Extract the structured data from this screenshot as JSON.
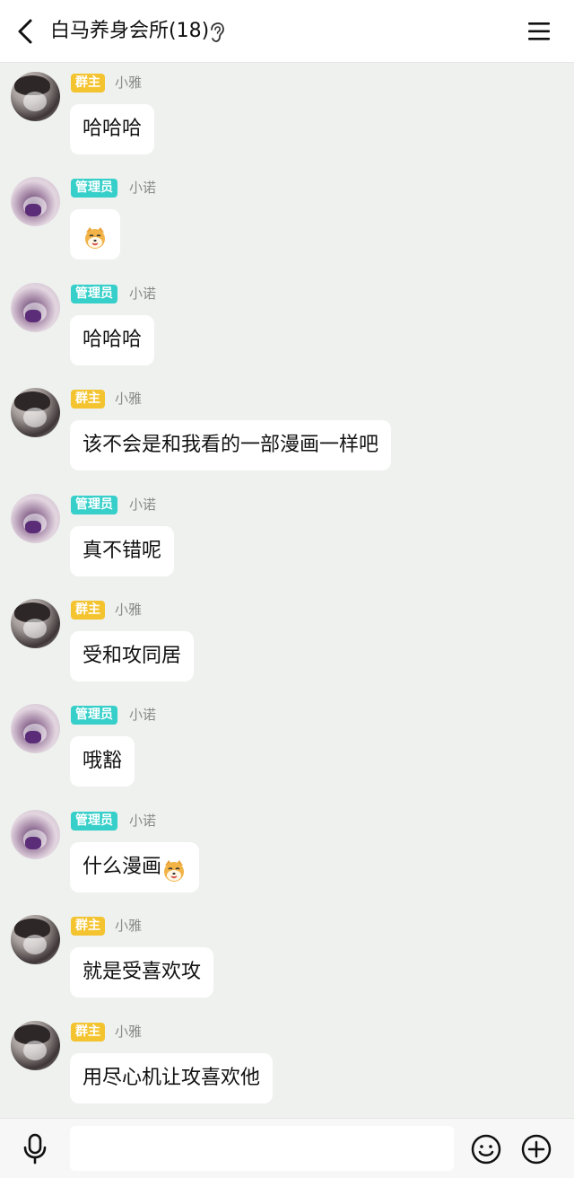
{
  "header": {
    "title": "白马养身会所(18)"
  },
  "icons": {
    "back": "chevron-left-icon",
    "ear": "ear-icon",
    "menu": "hamburger-menu-icon",
    "mic": "microphone-icon",
    "emoji": "smiley-icon",
    "plus": "plus-circle-icon",
    "sticker": "shiba-dog-emoji"
  },
  "colors": {
    "owner_badge": "#f4c430",
    "admin_badge": "#36cfc9",
    "chat_bg": "#eef1ee"
  },
  "messages": [
    {
      "role": "owner",
      "badge": "群主",
      "name": "小雅",
      "text": "哈哈哈"
    },
    {
      "role": "admin",
      "badge": "管理员",
      "name": "小诺",
      "text": "",
      "sticker": true
    },
    {
      "role": "admin",
      "badge": "管理员",
      "name": "小诺",
      "text": "哈哈哈"
    },
    {
      "role": "owner",
      "badge": "群主",
      "name": "小雅",
      "text": "该不会是和我看的一部漫画一样吧"
    },
    {
      "role": "admin",
      "badge": "管理员",
      "name": "小诺",
      "text": "真不错呢"
    },
    {
      "role": "owner",
      "badge": "群主",
      "name": "小雅",
      "text": "受和攻同居"
    },
    {
      "role": "admin",
      "badge": "管理员",
      "name": "小诺",
      "text": "哦豁"
    },
    {
      "role": "admin",
      "badge": "管理员",
      "name": "小诺",
      "text": "什么漫画",
      "sticker": true
    },
    {
      "role": "owner",
      "badge": "群主",
      "name": "小雅",
      "text": "就是受喜欢攻"
    },
    {
      "role": "owner",
      "badge": "群主",
      "name": "小雅",
      "text": "用尽心机让攻喜欢他"
    }
  ],
  "composer": {
    "value": "",
    "placeholder": ""
  }
}
